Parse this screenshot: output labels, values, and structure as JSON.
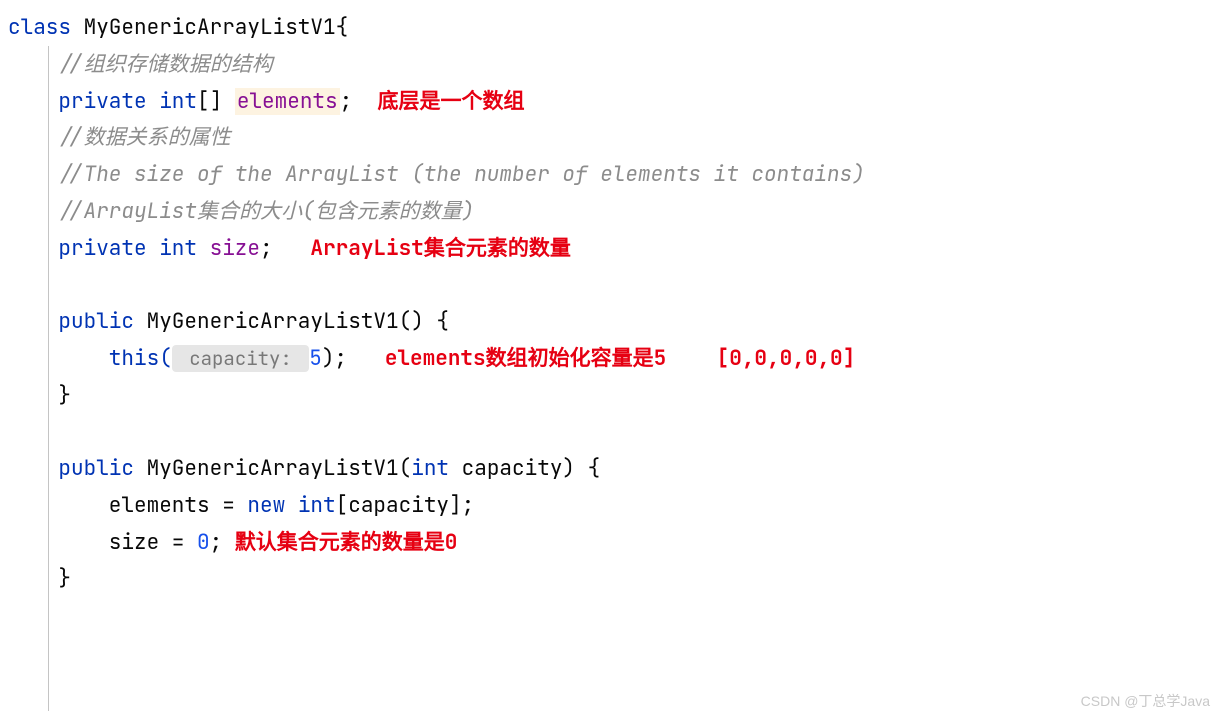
{
  "code": {
    "line1_keyword_class": "class",
    "line1_class_name": " MyGenericArrayListV1{",
    "line2_comment": "    //组织存储数据的结构",
    "line3_keyword_private": "    private ",
    "line3_keyword_int": "int",
    "line3_brackets": "[] ",
    "line3_field": "elements",
    "line3_semi": ";  ",
    "line3_annotation": "底层是一个数组",
    "line4_comment": "    //数据关系的属性",
    "line5_comment": "    //The size of the ArrayList (the number of elements it contains)",
    "line6_comment": "    //ArrayList集合的大小(包含元素的数量)",
    "line7_keyword_private": "    private ",
    "line7_keyword_int": "int ",
    "line7_field": "size",
    "line7_semi": ";   ",
    "line7_annotation": "ArrayList集合元素的数量",
    "line9_keyword_public": "    public ",
    "line9_ctor": "MyGenericArrayListV1() {",
    "line10_this_open": "        this(",
    "line10_hint": " capacity: ",
    "line10_num": "5",
    "line10_close": ");   ",
    "line10_annotation": "elements数组初始化容量是5    [0,0,0,0,0]",
    "line11_close": "    }",
    "line13_keyword_public": "    public ",
    "line13_ctor": "MyGenericArrayListV1(",
    "line13_keyword_int": "int",
    "line13_param": " capacity) {",
    "line14_text": "        elements = ",
    "line14_keyword_new": "new ",
    "line14_keyword_int": "int",
    "line14_rest": "[capacity];",
    "line15_text": "        size = ",
    "line15_num": "0",
    "line15_semi": "; ",
    "line15_annotation": "默认集合元素的数量是0",
    "line16_close": "    }"
  },
  "watermark": "CSDN @丁总学Java"
}
